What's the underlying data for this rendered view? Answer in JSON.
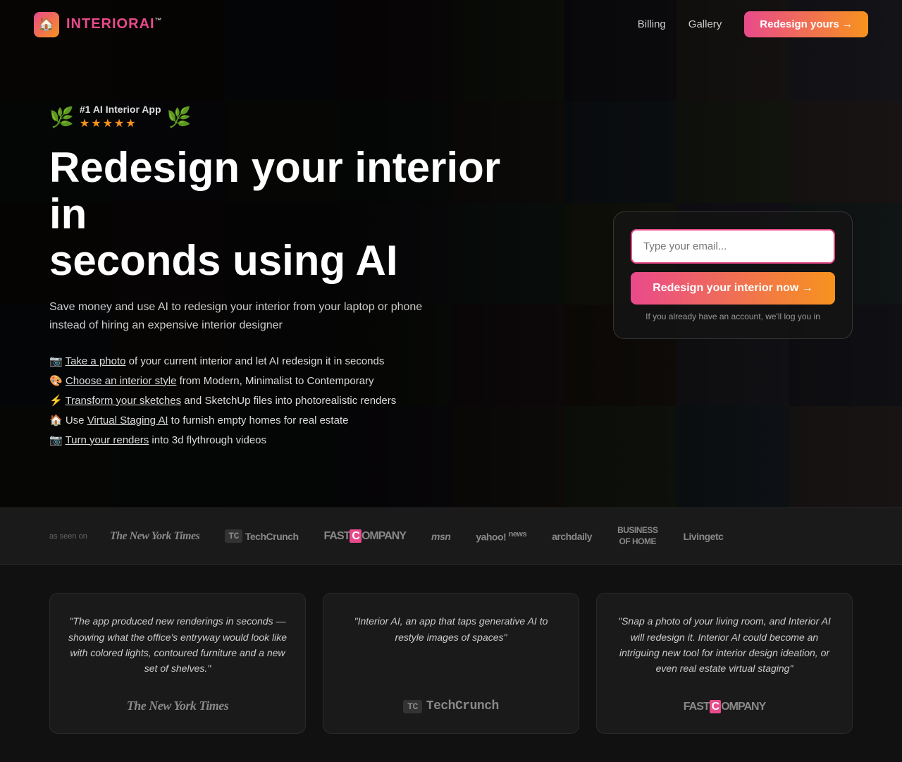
{
  "nav": {
    "logo_icon": "🏠",
    "logo_text_plain": "INTERIOR",
    "logo_text_accent": "AI",
    "logo_tm": "™",
    "billing_label": "Billing",
    "gallery_label": "Gallery",
    "cta_label": "Redesign yours →"
  },
  "hero": {
    "badge_rank": "#1 AI Interior App",
    "badge_stars": "★★★★★",
    "h1_line1": "Redesign your interior in",
    "h1_line2": "seconds using AI",
    "subtitle": "Save money and use AI to redesign your interior from your laptop or phone instead of hiring an expensive interior designer",
    "features": [
      {
        "emoji": "📷",
        "link_text": "Take a photo",
        "rest": " of your current interior and let AI redesign it in seconds"
      },
      {
        "emoji": "🎨",
        "link_text": "Choose an interior style",
        "rest": " from Modern, Minimalist to Contemporary"
      },
      {
        "emoji": "⚡",
        "link_text": "Transform your sketches",
        "rest": " and SketchUp files into photorealistic renders"
      },
      {
        "emoji": "🏠",
        "link_text": "Virtual Staging AI",
        "prefix": "Use ",
        "rest": " to furnish empty homes for real estate"
      },
      {
        "emoji": "📷",
        "link_text": "Turn your renders",
        "rest": " into 3d flythrough videos"
      }
    ],
    "email_placeholder": "Type your email...",
    "redesign_btn": "Redesign your interior now →",
    "login_hint": "If you already have an account, we'll log you in"
  },
  "press": {
    "as_seen_on": "as seen on",
    "logos": [
      {
        "text": "The New York Times",
        "style": "serif"
      },
      {
        "text": "TechCrunch",
        "prefix": "TC ",
        "style": "tc"
      },
      {
        "text": "FAST COMPANY",
        "style": "bold"
      },
      {
        "text": "msn",
        "style": "bold"
      },
      {
        "text": "yahoo! news",
        "style": "bold"
      },
      {
        "text": "archdaily",
        "style": "bold"
      },
      {
        "text": "BUSINESS OF HOME",
        "style": "bold"
      },
      {
        "text": "Livingetc",
        "style": "bold"
      }
    ]
  },
  "testimonials": [
    {
      "quote": "\"The app produced new renderings in seconds — showing what the office's entryway would look like with colored lights, contoured furniture and a new set of shelves.\"",
      "source": "The New York Times",
      "source_style": "serif"
    },
    {
      "quote": "\"Interior AI, an app that taps generative AI to restyle images of spaces\"",
      "source": "TechCrunch",
      "source_style": "tc"
    },
    {
      "quote": "\"Snap a photo of your living room, and Interior AI will redesign it. Interior AI could become an intriguing new tool for interior design ideation, or even real estate virtual staging\"",
      "source": "FAST COMPANY",
      "source_style": "bold"
    }
  ],
  "colors": {
    "accent_pink": "#e94a8b",
    "accent_orange": "#f7931e",
    "bg_dark": "#111111",
    "bg_card": "#1a1a1a"
  }
}
